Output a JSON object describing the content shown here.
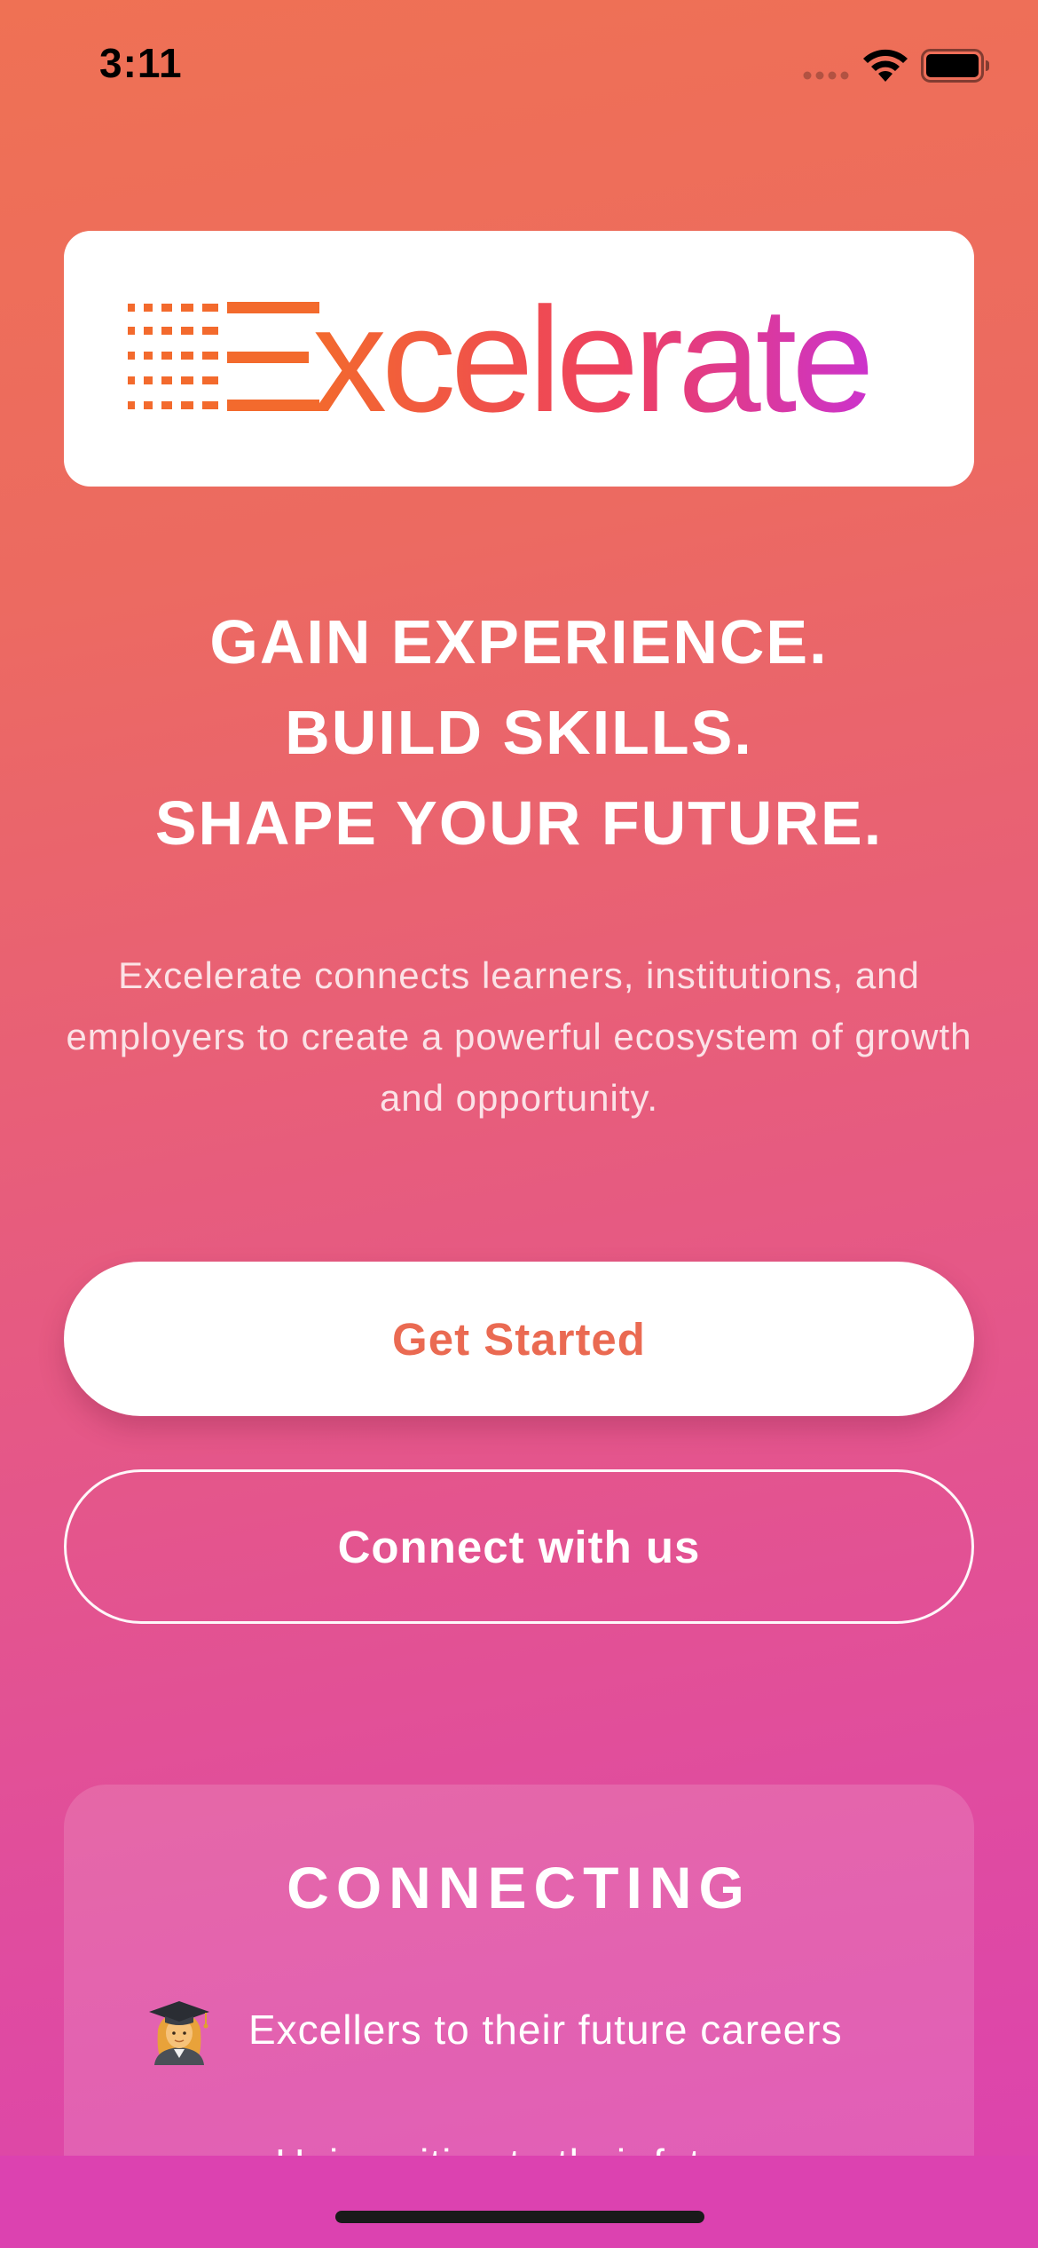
{
  "status_bar": {
    "time": "3:11",
    "icons": [
      "signal-icon",
      "wifi-icon",
      "battery-icon"
    ]
  },
  "logo": {
    "text": "Excelerate",
    "colors": {
      "start": "#f36a2d",
      "end": "#cc33cc"
    }
  },
  "hero": {
    "headline_lines": [
      "GAIN EXPERIENCE.",
      "BUILD SKILLS.",
      "SHAPE YOUR FUTURE."
    ],
    "description": "Excelerate connects learners, institutions, and employers to create a powerful ecosystem of growth and opportunity."
  },
  "buttons": {
    "get_started": "Get Started",
    "connect": "Connect with us"
  },
  "connecting": {
    "title": "CONNECTING",
    "items": [
      {
        "icon": "graduate-icon",
        "text": "Excellers to their future careers"
      },
      {
        "text": "Universities to their future"
      }
    ]
  },
  "colors": {
    "gradient_top": "#ef7154",
    "gradient_bottom": "#dc42b0",
    "primary_button_text": "#ea6a52"
  }
}
